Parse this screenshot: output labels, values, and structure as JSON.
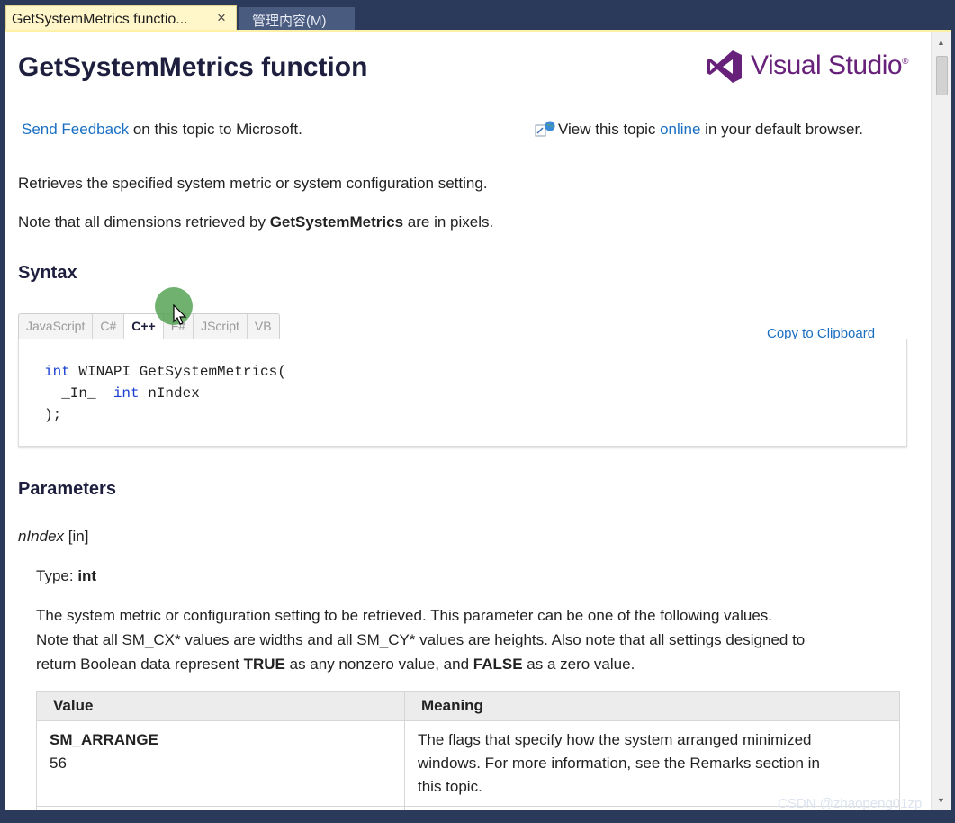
{
  "tabs": [
    {
      "label": "GetSystemMetrics functio...",
      "close_icon": "×"
    },
    {
      "label": "管理内容(M)"
    }
  ],
  "header": {
    "title": "GetSystemMetrics function",
    "logo_text": "Visual Studio",
    "logo_tm": "®"
  },
  "feedback": {
    "link": "Send Feedback",
    "rest": " on this topic to Microsoft."
  },
  "online": {
    "pre": "View this topic ",
    "link": "online",
    "post": " in your default browser."
  },
  "intro": {
    "line1": "Retrieves the specified system metric or system configuration setting.",
    "line2_pre": "Note that all dimensions retrieved by ",
    "line2_bold": "GetSystemMetrics",
    "line2_post": " are in pixels."
  },
  "syntax": {
    "heading": "Syntax",
    "lang_tabs": [
      "JavaScript",
      "C#",
      "C++",
      "F#",
      "JScript",
      "VB"
    ],
    "active_tab": "C++",
    "copy_label": "Copy to Clipboard",
    "code_lines": [
      {
        "kw": "int",
        "rest": " WINAPI GetSystemMetrics("
      },
      {
        "pre": "  _In_  ",
        "kw": "int",
        "rest": " nIndex"
      },
      {
        "rest": ");"
      }
    ]
  },
  "parameters": {
    "heading": "Parameters",
    "param_name": "nIndex",
    "param_dir": " [in]",
    "type_label": "Type: ",
    "type_value": "int",
    "desc_line1": "The system metric or configuration setting to be retrieved. This parameter can be one of the following values.",
    "desc_line2": "Note that all SM_CX* values are widths and all SM_CY* values are heights. Also note that all settings designed to",
    "desc_line3_a": "return Boolean data represent ",
    "desc_line3_b": "TRUE",
    "desc_line3_c": " as any nonzero value, and ",
    "desc_line3_d": "FALSE",
    "desc_line3_e": " as a zero value.",
    "table": {
      "headers": [
        "Value",
        "Meaning"
      ],
      "rows": [
        {
          "name": "SM_ARRANGE",
          "code": "56",
          "meaning_lines": [
            "The flags that specify how the system arranged minimized",
            "windows. For more information, see the Remarks section in",
            "this topic."
          ]
        }
      ]
    }
  },
  "watermark": "CSDN @zhaopeng01zp"
}
